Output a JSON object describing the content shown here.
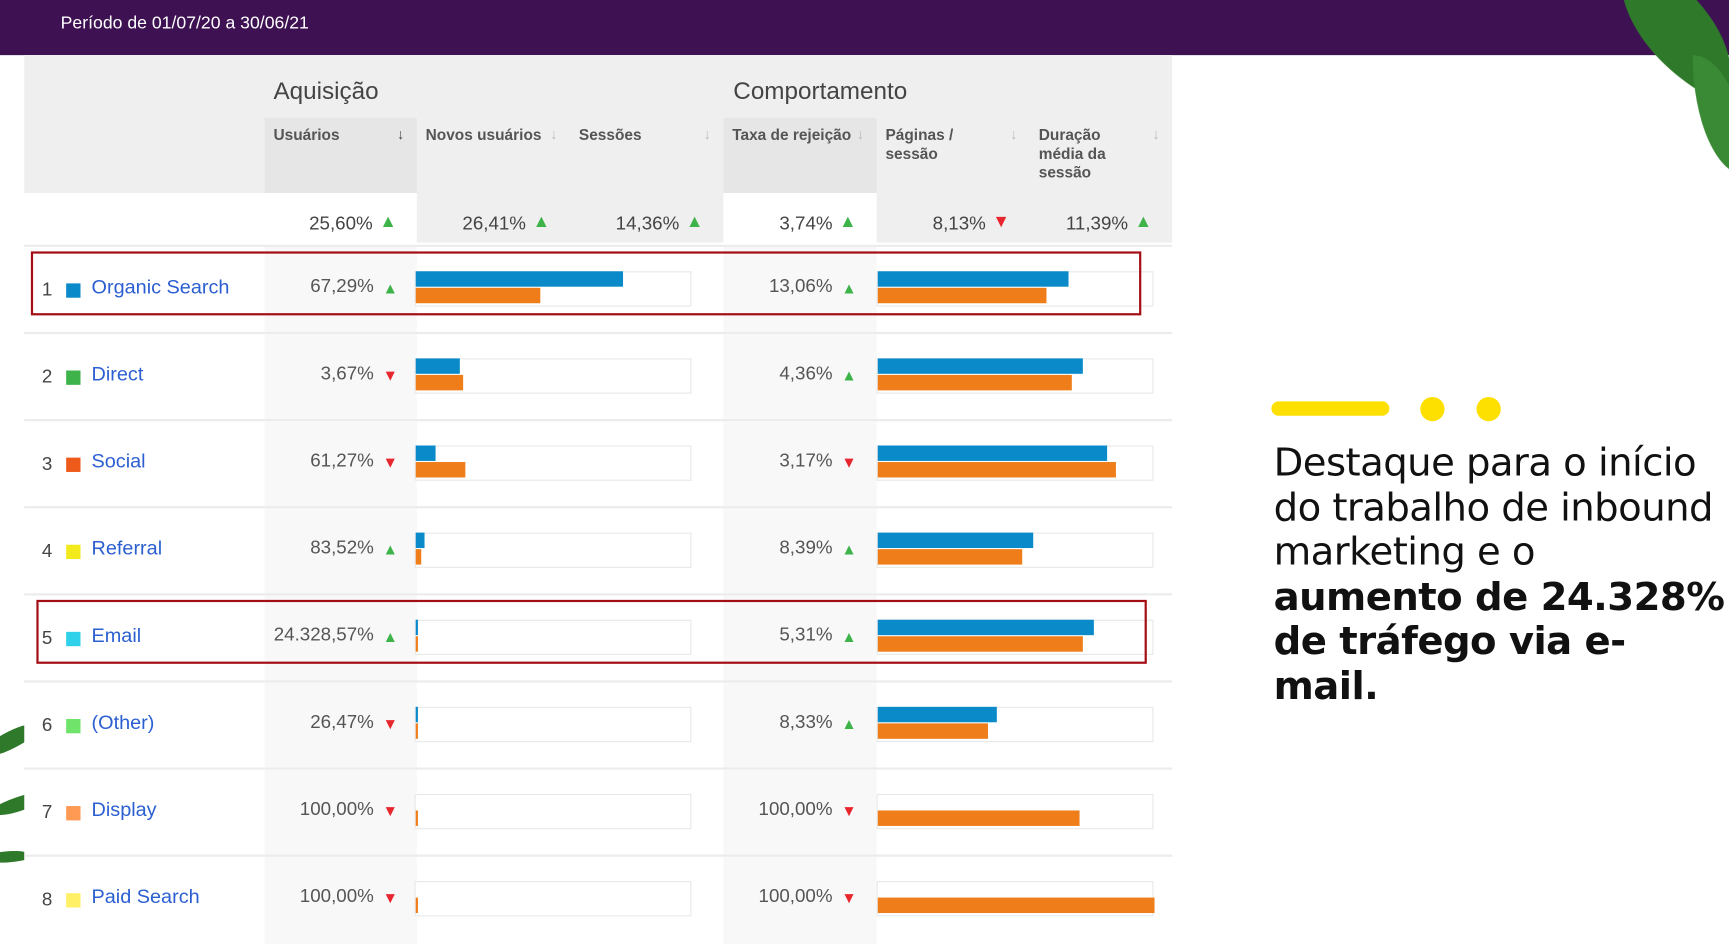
{
  "header": {
    "period": "Período de 01/07/20 a 30/06/21"
  },
  "groups": {
    "acquisition": "Aquisição",
    "behavior": "Comportamento"
  },
  "columns": [
    "Usuários",
    "Novos usuários",
    "Sessões",
    "Taxa de rejeição",
    "Páginas / sessão",
    "Duração média da sessão"
  ],
  "totals": [
    {
      "value": "25,60%",
      "trend": "up"
    },
    {
      "value": "26,41%",
      "trend": "up"
    },
    {
      "value": "14,36%",
      "trend": "up"
    },
    {
      "value": "3,74%",
      "trend": "up"
    },
    {
      "value": "8,13%",
      "trend": "down"
    },
    {
      "value": "11,39%",
      "trend": "up"
    }
  ],
  "colors": {
    "current": "#0a8ac9",
    "previous": "#ee7d1a",
    "up": "#3db34a",
    "down": "#e8262d",
    "highlight": "#a30d14",
    "accent": "#fde000",
    "header": "#3d1152"
  },
  "rows": [
    {
      "num": "1",
      "label": "Organic Search",
      "swatch": "#0a8ac9",
      "users": "67,29%",
      "users_trend": "up",
      "bounce": "13,06%",
      "bounce_trend": "up",
      "acq_bars": [
        0.75,
        0.45
      ],
      "beh_bars": [
        0.69,
        0.61
      ],
      "highlighted": true
    },
    {
      "num": "2",
      "label": "Direct",
      "swatch": "#3db34a",
      "users": "3,67%",
      "users_trend": "down",
      "bounce": "4,36%",
      "bounce_trend": "up",
      "acq_bars": [
        0.16,
        0.17
      ],
      "beh_bars": [
        0.74,
        0.7
      ],
      "highlighted": false
    },
    {
      "num": "3",
      "label": "Social",
      "swatch": "#ee5a1a",
      "users": "61,27%",
      "users_trend": "down",
      "bounce": "3,17%",
      "bounce_trend": "down",
      "acq_bars": [
        0.07,
        0.18
      ],
      "beh_bars": [
        0.83,
        0.86
      ],
      "highlighted": false
    },
    {
      "num": "4",
      "label": "Referral",
      "swatch": "#f2ea1d",
      "users": "83,52%",
      "users_trend": "up",
      "bounce": "8,39%",
      "bounce_trend": "up",
      "acq_bars": [
        0.03,
        0.02
      ],
      "beh_bars": [
        0.56,
        0.52
      ],
      "highlighted": false
    },
    {
      "num": "5",
      "label": "Email",
      "swatch": "#2fd0ea",
      "users": "24.328,57%",
      "users_trend": "up",
      "bounce": "5,31%",
      "bounce_trend": "up",
      "acq_bars": [
        0.006,
        0.006
      ],
      "beh_bars": [
        0.78,
        0.74
      ],
      "highlighted": true
    },
    {
      "num": "6",
      "label": "(Other)",
      "swatch": "#6fe36a",
      "users": "26,47%",
      "users_trend": "down",
      "bounce": "8,33%",
      "bounce_trend": "up",
      "acq_bars": [
        0.006,
        0.006
      ],
      "beh_bars": [
        0.43,
        0.4
      ],
      "highlighted": false
    },
    {
      "num": "7",
      "label": "Display",
      "swatch": "#ff9a55",
      "users": "100,00%",
      "users_trend": "down",
      "bounce": "100,00%",
      "bounce_trend": "down",
      "acq_bars": [
        0,
        0.006
      ],
      "beh_bars": [
        0,
        0.73
      ],
      "highlighted": false
    },
    {
      "num": "8",
      "label": "Paid Search",
      "swatch": "#fff066",
      "users": "100,00%",
      "users_trend": "down",
      "bounce": "100,00%",
      "bounce_trend": "down",
      "acq_bars": [
        0,
        0.006
      ],
      "beh_bars": [
        0,
        1.0
      ],
      "highlighted": false
    }
  ],
  "blurb": {
    "normal": "Destaque para o início do trabalho de inbound marketing e o ",
    "bold": "aumento de 24.328% de tráfego via e-mail."
  }
}
